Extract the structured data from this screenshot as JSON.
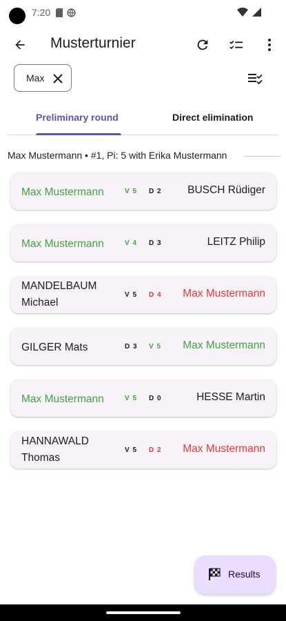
{
  "status_bar": {
    "time": "7:20"
  },
  "app_bar": {
    "title": "Musterturnier"
  },
  "filter": {
    "chip_label": "Max"
  },
  "tabs": [
    {
      "label": "Preliminary round",
      "active": true
    },
    {
      "label": "Direct elimination",
      "active": false
    }
  ],
  "section": {
    "header": "Max Mustermann • #1, Pi: 5 with Erika Mustermann"
  },
  "matches": [
    {
      "left_name": "Max Mustermann",
      "left_score": "V 5",
      "right_score": "D 2",
      "right_name": "BUSCH Rüdiger"
    },
    {
      "left_name": "Max Mustermann",
      "left_score": "V 4",
      "right_score": "D 3",
      "right_name": "LEITZ Philip"
    },
    {
      "left_name": "MANDELBAUM Michael",
      "left_score": "V 5",
      "right_score": "D 4",
      "right_name": "Max Mustermann"
    },
    {
      "left_name": "GILGER Mats",
      "left_score": "D 3",
      "right_score": "V 5",
      "right_name": "Max Mustermann"
    },
    {
      "left_name": "Max Mustermann",
      "left_score": "V 5",
      "right_score": "D 0",
      "right_name": "HESSE Martin"
    },
    {
      "left_name": "HANNAWALD Thomas",
      "left_score": "V 5",
      "right_score": "D 2",
      "right_name": "Max Mustermann"
    }
  ],
  "fab": {
    "label": "Results"
  },
  "colors": {
    "accent": "#6750a4",
    "win": "#43a047",
    "loss": "#e53935",
    "card": "#f7f2f7",
    "fab": "#eaddff"
  }
}
